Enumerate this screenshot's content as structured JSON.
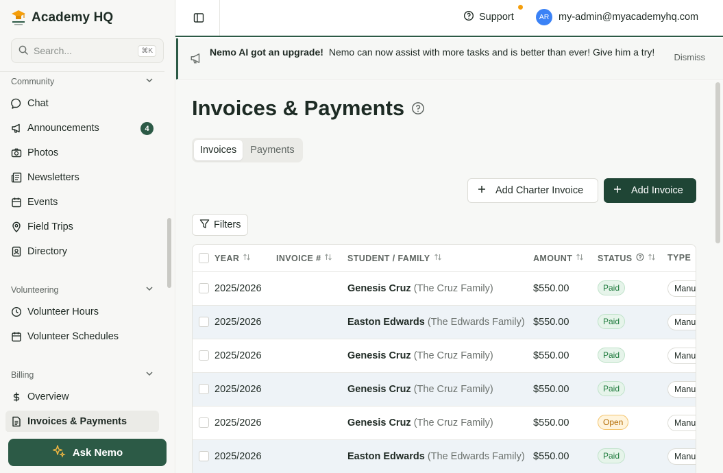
{
  "brand": {
    "title": "Academy HQ"
  },
  "search": {
    "placeholder": "Search...",
    "shortcut": "⌘K"
  },
  "sidebar": {
    "sections": [
      {
        "label": "Community",
        "items": [
          {
            "label": "Chat",
            "icon": "chat-icon"
          },
          {
            "label": "Announcements",
            "icon": "megaphone-icon",
            "badge": "4"
          },
          {
            "label": "Photos",
            "icon": "camera-icon"
          },
          {
            "label": "Newsletters",
            "icon": "newspaper-icon"
          },
          {
            "label": "Events",
            "icon": "calendar-icon"
          },
          {
            "label": "Field Trips",
            "icon": "map-pin-icon"
          },
          {
            "label": "Directory",
            "icon": "contact-book-icon"
          }
        ]
      },
      {
        "label": "Volunteering",
        "items": [
          {
            "label": "Volunteer Hours",
            "icon": "clock-icon"
          },
          {
            "label": "Volunteer Schedules",
            "icon": "calendar-icon"
          }
        ]
      },
      {
        "label": "Billing",
        "items": [
          {
            "label": "Overview",
            "icon": "dollar-icon"
          },
          {
            "label": "Invoices & Payments",
            "icon": "document-icon",
            "active": true
          }
        ]
      }
    ],
    "ask_nemo": "Ask Nemo"
  },
  "topbar": {
    "support": "Support",
    "avatar_initials": "AR",
    "user_email": "my-admin@myacademyhq.com",
    "notification_color": "#f59e0b"
  },
  "banner": {
    "title": "Nemo AI got an upgrade!",
    "message": "Nemo can now assist with more tasks and is better than ever! Give him a try!",
    "dismiss": "Dismiss"
  },
  "page": {
    "title": "Invoices & Payments",
    "tabs": [
      {
        "label": "Invoices",
        "active": true
      },
      {
        "label": "Payments",
        "active": false
      }
    ],
    "add_charter_invoice": "Add Charter Invoice",
    "add_invoice": "Add Invoice",
    "filters": "Filters"
  },
  "table": {
    "columns": [
      "YEAR",
      "INVOICE #",
      "STUDENT / FAMILY",
      "AMOUNT",
      "STATUS",
      "TYPE"
    ],
    "rows": [
      {
        "year": "2025/2026",
        "invoice": "",
        "student": "Genesis Cruz",
        "family": "(The Cruz Family)",
        "amount": "$550.00",
        "status": "Paid",
        "type": "Manual"
      },
      {
        "year": "2025/2026",
        "invoice": "",
        "student": "Easton Edwards",
        "family": "(The Edwards Family)",
        "amount": "$550.00",
        "status": "Paid",
        "type": "Manual"
      },
      {
        "year": "2025/2026",
        "invoice": "",
        "student": "Genesis Cruz",
        "family": "(The Cruz Family)",
        "amount": "$550.00",
        "status": "Paid",
        "type": "Manual"
      },
      {
        "year": "2025/2026",
        "invoice": "",
        "student": "Genesis Cruz",
        "family": "(The Cruz Family)",
        "amount": "$550.00",
        "status": "Paid",
        "type": "Manual"
      },
      {
        "year": "2025/2026",
        "invoice": "",
        "student": "Genesis Cruz",
        "family": "(The Cruz Family)",
        "amount": "$550.00",
        "status": "Open",
        "type": "Manual"
      },
      {
        "year": "2025/2026",
        "invoice": "",
        "student": "Easton Edwards",
        "family": "(The Edwards Family)",
        "amount": "$550.00",
        "status": "Paid",
        "type": "Manual"
      }
    ]
  },
  "colors": {
    "brand": "#2c5a46",
    "brand_dark": "#1f4535",
    "paid": "#1e7a3c",
    "open": "#b26a00",
    "avatar": "#3b82f6"
  }
}
